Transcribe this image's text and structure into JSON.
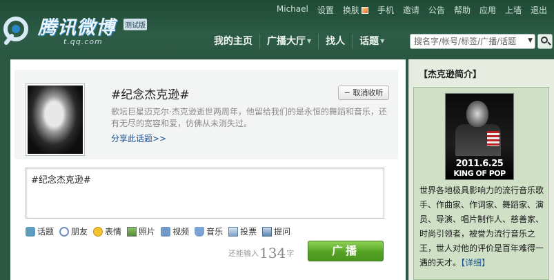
{
  "header": {
    "logo_brand": "腾讯微博",
    "logo_badge": "测试版",
    "logo_domain": "t.qq.com",
    "top_links": [
      "Michael",
      "设置",
      "换肤",
      "手机",
      "邀请",
      "公告",
      "帮助",
      "应用",
      "上墙",
      "退出"
    ],
    "nav": [
      {
        "label": "我的主页",
        "has_arrow": false
      },
      {
        "label": "广播大厅",
        "has_arrow": true
      },
      {
        "label": "找人",
        "has_arrow": false
      },
      {
        "label": "话题",
        "has_arrow": true
      }
    ],
    "search_placeholder": "搜名字/帐号/标签/广播/话题"
  },
  "topic": {
    "title": "#纪念杰克逊#",
    "unfollow_label": "− 取消收听",
    "description": "歌坛巨星迈克尔·杰克逊逝世两周年，他留给我们的是永恒的舞蹈和音乐，还有无尽的宽容和爱，仿佛从未消失过。",
    "share_link": "分享此话题>>"
  },
  "composer": {
    "text": "#纪念杰克逊#",
    "tools": [
      {
        "label": "话题",
        "icon": "topic-icon"
      },
      {
        "label": "朋友",
        "icon": "at-icon"
      },
      {
        "label": "表情",
        "icon": "emoticon-icon"
      },
      {
        "label": "照片",
        "icon": "photo-icon"
      },
      {
        "label": "视频",
        "icon": "video-icon"
      },
      {
        "label": "音乐",
        "icon": "music-icon"
      },
      {
        "label": "投票",
        "icon": "vote-icon"
      },
      {
        "label": "提问",
        "icon": "ask-icon"
      }
    ],
    "counter_prefix": "还能输入",
    "counter_value": "134",
    "counter_suffix": "字",
    "submit_label": "广播"
  },
  "sidebar": {
    "title": "【杰克逊简介】",
    "image_date": "2011.6.25",
    "image_caption": "KING OF POP",
    "intro": "世界各地极具影响力的流行音乐歌手、作曲家、作词家、舞蹈家、演员、导演、唱片制作人、慈善家、时尚引领者，被誉为流行音乐之王，世人对他的评价是百年难得一遇的天才。",
    "more_link": "【详细】"
  },
  "colors": {
    "header_bg": "#2b5743",
    "broadcast_green": "#55a324",
    "link_blue": "#1e5494",
    "sidebar_bg": "#cfe0c6"
  }
}
